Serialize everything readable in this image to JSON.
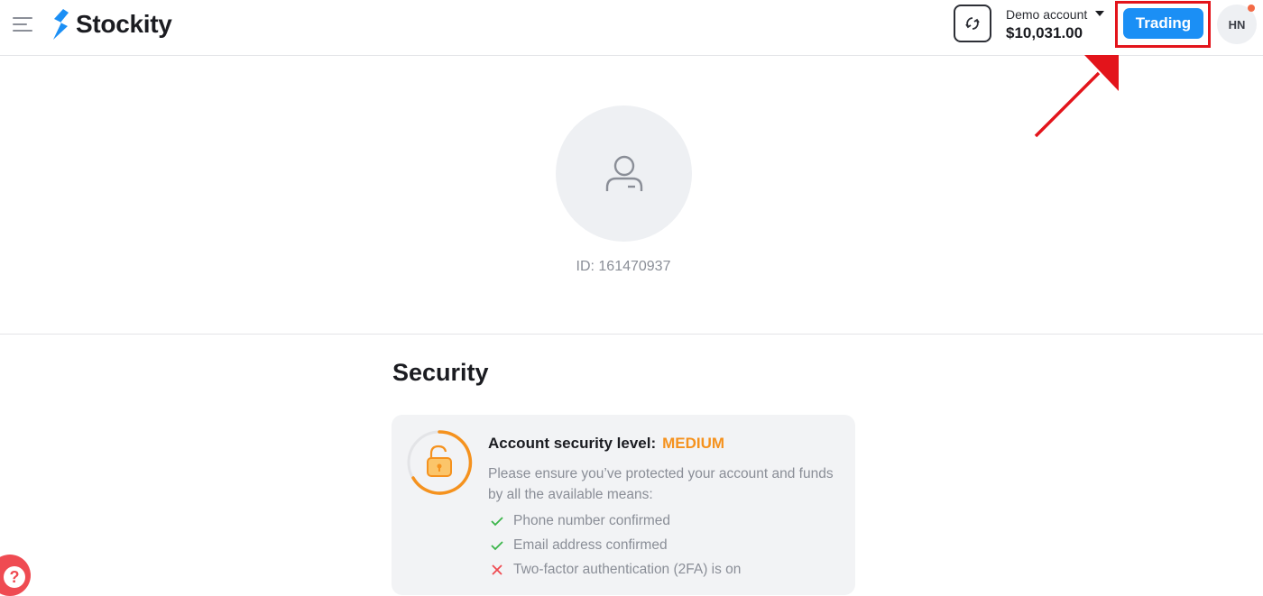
{
  "app": {
    "logo_text": "Stockity",
    "brand_color": "#1b8ff5",
    "accent_warning": "#f5921e",
    "annotation_color": "#e3141b"
  },
  "header": {
    "menu_icon": "hamburger-icon",
    "switch_icon": "swap-arrows-icon",
    "account_type": "Demo account",
    "account_balance": "$10,031.00",
    "trading_label": "Trading",
    "user_initials": "HN"
  },
  "profile": {
    "avatar_icon": "user-icon",
    "id_text": "ID: 161470937"
  },
  "security": {
    "title": "Security",
    "level_label": "Account security level:",
    "level_value": "MEDIUM",
    "description": "Please ensure you’ve protected your account and funds by all the available means:",
    "items": [
      {
        "label": "Phone number confirmed",
        "status": "done",
        "icon": "check-icon",
        "color": "#3bb54a"
      },
      {
        "label": "Email address confirmed",
        "status": "done",
        "icon": "check-icon",
        "color": "#3bb54a"
      },
      {
        "label": "Two-factor authentication (2FA) is on",
        "status": "missing",
        "icon": "cross-icon",
        "color": "#ef4b52"
      }
    ]
  },
  "help": {
    "label": "?"
  }
}
